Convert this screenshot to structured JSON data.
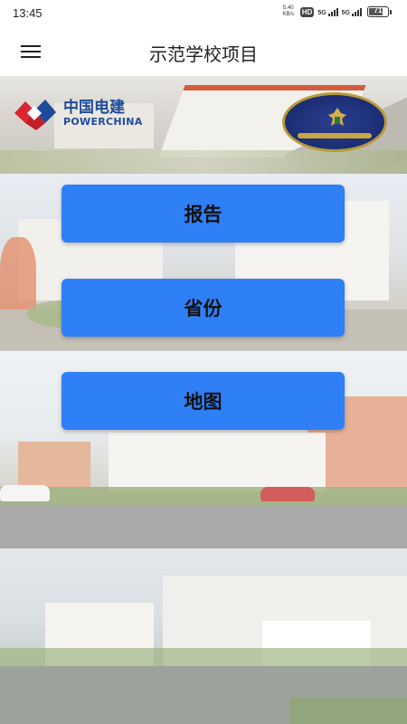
{
  "status_bar": {
    "time": "13:45",
    "net_speed_value": "5.40",
    "net_speed_unit": "KB/s",
    "hd_label": "HD",
    "signal_1_label": "5G",
    "signal_2_label": "5G",
    "battery_level": "71"
  },
  "app_bar": {
    "menu_icon": "hamburger-menu-icon",
    "title": "示范学校项目"
  },
  "banner": {
    "logo_left_cn": "中国电建",
    "logo_left_en": "POWERCHINA"
  },
  "actions": [
    {
      "label": "报告"
    },
    {
      "label": "省份"
    },
    {
      "label": "地图"
    }
  ],
  "colors": {
    "button_bg": "#2f7ff7",
    "brand_blue": "#1f4b9b",
    "brand_red": "#d9262f"
  }
}
